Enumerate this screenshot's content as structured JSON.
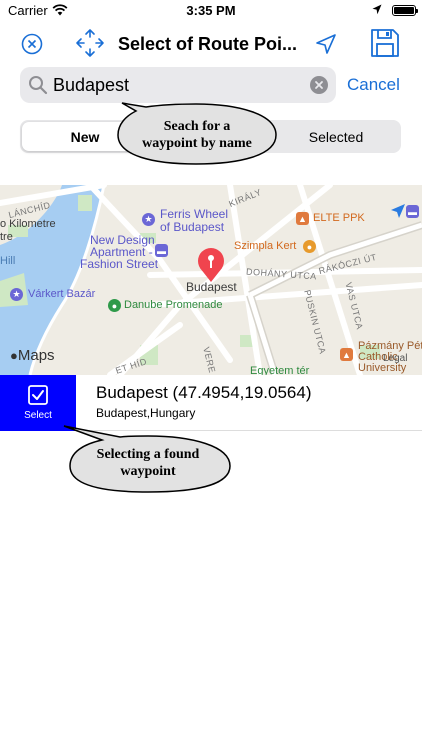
{
  "status_bar": {
    "carrier": "Carrier",
    "time": "3:35 PM"
  },
  "nav": {
    "title": "Select of Route Poi...",
    "accent_color": "#1a6fd6"
  },
  "search": {
    "value": "Budapest",
    "placeholder": "",
    "cancel_label": "Cancel"
  },
  "segments": {
    "items": [
      {
        "label": "New",
        "selected": true
      },
      {
        "label": "Selected",
        "selected": false
      }
    ]
  },
  "callouts": {
    "search_line1": "Seach for a",
    "search_line2": "waypoint by name",
    "select_line1": "Selecting a found",
    "select_line2": "waypoint"
  },
  "map": {
    "labels": {
      "lanchid": "LÁNCHÍD",
      "kilometre1": "o Kilometre",
      "kilometre2": "tre",
      "hill": "Hill",
      "varkert": "Várkert Bazár",
      "ferris1": "Ferris Wheel",
      "ferris2": "of Budapest",
      "newdesign1": "New Design",
      "newdesign2": "Apartment -",
      "newdesign3": "Fashion Street",
      "danube": "Danube Promenade",
      "budapest": "Budapest",
      "kiraly": "KIRÁLY",
      "elte": "ELTE PPK",
      "szimpla": "Szimpla Kert",
      "dohany": "DOHÁNY UTCA",
      "rakoczi": "RÁKÓCZI ÚT",
      "puskin": "PUSKIN UTCA",
      "vas": "VAS UTCA",
      "pazmany1": "Pázmány Pét",
      "pazmany2": "Catholic",
      "pazmany3": "University",
      "egyetem": "Egyetem tér",
      "hid": "ET HÍD",
      "vere": "VERE"
    },
    "logo": "Maps",
    "legal": "Legal",
    "water_color": "#a6cdf2",
    "park_color": "#cfe8c4"
  },
  "result": {
    "select_label": "Select",
    "select_color": "#0000ff",
    "title": "Budapest (47.4954,19.0564)",
    "subtitle": "Budapest,Hungary"
  },
  "icons": [
    "wifi-icon",
    "location-arrow-icon",
    "battery-icon",
    "close-circle-icon",
    "move-arrows-icon",
    "navigation-arrow-icon",
    "save-icon",
    "search-icon",
    "clear-icon",
    "checkbox-icon",
    "map-pin-icon"
  ]
}
